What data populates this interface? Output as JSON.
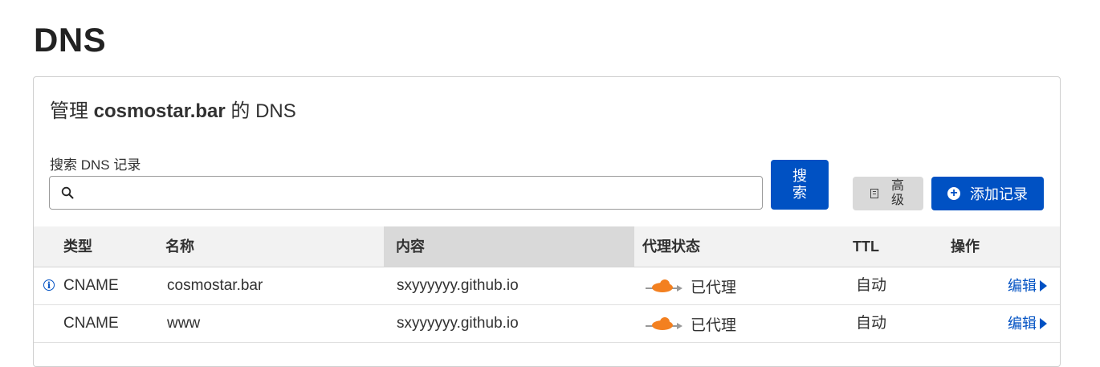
{
  "page": {
    "title": "DNS"
  },
  "card": {
    "title_prefix": "管理",
    "domain": "cosmostar.bar",
    "title_suffix": "的 DNS",
    "search_label": "搜索 DNS 记录",
    "search_value": "",
    "search_button": "搜索",
    "advanced_button": "高级",
    "add_button": "添加记录"
  },
  "table": {
    "columns": {
      "type": "类型",
      "name": "名称",
      "content": "内容",
      "proxy": "代理状态",
      "ttl": "TTL",
      "actions": "操作"
    },
    "rows": [
      {
        "type": "CNAME",
        "name": "cosmostar.bar",
        "content": "sxyyyyyy.github.io",
        "proxy": "已代理",
        "ttl": "自动",
        "action": "编辑"
      },
      {
        "type": "CNAME",
        "name": "www",
        "content": "sxyyyyyy.github.io",
        "proxy": "已代理",
        "ttl": "自动",
        "action": "编辑"
      }
    ]
  },
  "colors": {
    "accent": "#0051c3",
    "proxy_orange": "#f38020"
  }
}
